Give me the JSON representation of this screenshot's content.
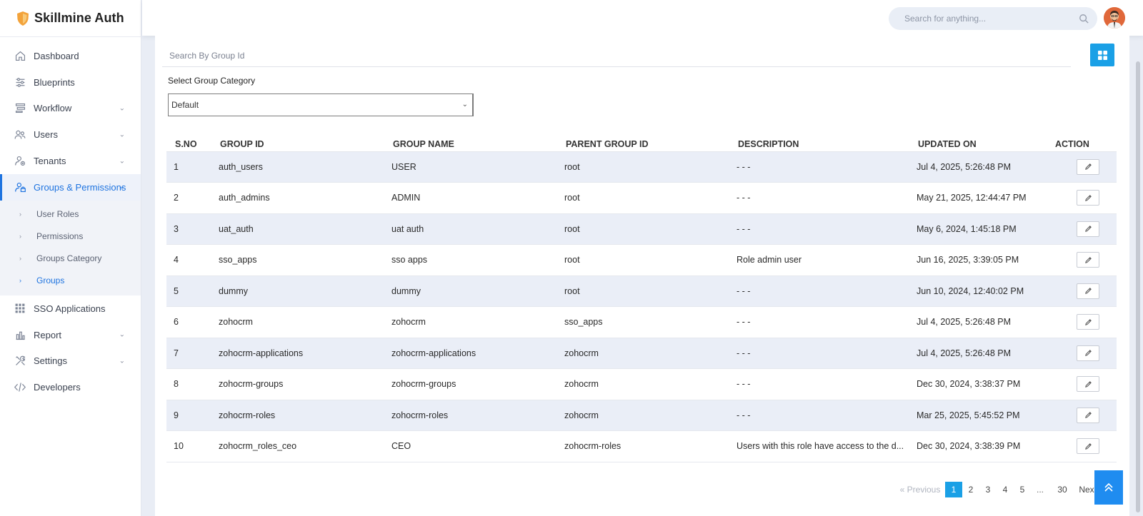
{
  "app": {
    "name": "Skillmine Auth"
  },
  "header": {
    "search_placeholder": "Search for anything..."
  },
  "sidebar": {
    "items": [
      {
        "label": "Dashboard",
        "icon": "home-icon",
        "has_chevron": false
      },
      {
        "label": "Blueprints",
        "icon": "sliders-icon",
        "has_chevron": false
      },
      {
        "label": "Workflow",
        "icon": "workflow-icon",
        "has_chevron": true
      },
      {
        "label": "Users",
        "icon": "users-icon",
        "has_chevron": true
      },
      {
        "label": "Tenants",
        "icon": "tenant-icon",
        "has_chevron": true
      },
      {
        "label": "Groups & Permissions",
        "icon": "user-lock-icon",
        "has_chevron": true,
        "active": true
      },
      {
        "label": "SSO Applications",
        "icon": "grid-icon",
        "has_chevron": false
      },
      {
        "label": "Report",
        "icon": "bar-chart-icon",
        "has_chevron": true
      },
      {
        "label": "Settings",
        "icon": "tools-icon",
        "has_chevron": true
      },
      {
        "label": "Developers",
        "icon": "code-icon",
        "has_chevron": false
      }
    ],
    "submenu": [
      {
        "label": "User Roles"
      },
      {
        "label": "Permissions"
      },
      {
        "label": "Groups Category"
      },
      {
        "label": "Groups",
        "active": true
      }
    ]
  },
  "main": {
    "group_search_placeholder": "Search By Group Id",
    "category_label": "Select Group Category",
    "category_value": "Default",
    "columns": [
      "S.NO",
      "GROUP ID",
      "GROUP NAME",
      "PARENT GROUP ID",
      "DESCRIPTION",
      "UPDATED ON",
      "ACTION"
    ],
    "rows": [
      {
        "sno": "1",
        "group_id": "auth_users",
        "group_name": "USER",
        "parent": "root",
        "description": "- - -",
        "updated": "Jul 4, 2025, 5:26:48 PM"
      },
      {
        "sno": "2",
        "group_id": "auth_admins",
        "group_name": "ADMIN",
        "parent": "root",
        "description": "- - -",
        "updated": "May 21, 2025, 12:44:47 PM"
      },
      {
        "sno": "3",
        "group_id": "uat_auth",
        "group_name": "uat auth",
        "parent": "root",
        "description": "- - -",
        "updated": "May 6, 2024, 1:45:18 PM"
      },
      {
        "sno": "4",
        "group_id": "sso_apps",
        "group_name": "sso apps",
        "parent": "root",
        "description": "Role admin user",
        "updated": "Jun 16, 2025, 3:39:05 PM"
      },
      {
        "sno": "5",
        "group_id": "dummy",
        "group_name": "dummy",
        "parent": "root",
        "description": "- - -",
        "updated": "Jun 10, 2024, 12:40:02 PM"
      },
      {
        "sno": "6",
        "group_id": "zohocrm",
        "group_name": "zohocrm",
        "parent": "sso_apps",
        "description": "- - -",
        "updated": "Jul 4, 2025, 5:26:48 PM"
      },
      {
        "sno": "7",
        "group_id": "zohocrm-applications",
        "group_name": "zohocrm-applications",
        "parent": "zohocrm",
        "description": "- - -",
        "updated": "Jul 4, 2025, 5:26:48 PM"
      },
      {
        "sno": "8",
        "group_id": "zohocrm-groups",
        "group_name": "zohocrm-groups",
        "parent": "zohocrm",
        "description": "- - -",
        "updated": "Dec 30, 2024, 3:38:37 PM"
      },
      {
        "sno": "9",
        "group_id": "zohocrm-roles",
        "group_name": "zohocrm-roles",
        "parent": "zohocrm",
        "description": "- - -",
        "updated": "Mar 25, 2025, 5:45:52 PM"
      },
      {
        "sno": "10",
        "group_id": "zohocrm_roles_ceo",
        "group_name": "CEO",
        "parent": "zohocrm-roles",
        "description": "Users with this role have access to the d...",
        "updated": "Dec 30, 2024, 3:38:39 PM"
      }
    ]
  },
  "pagination": {
    "previous": "« Previous",
    "pages": [
      "1",
      "2",
      "3",
      "4",
      "5"
    ],
    "ellipsis": "...",
    "last": "30",
    "next": "Nex",
    "current": "1"
  },
  "colors": {
    "accent": "#1f74e0",
    "button": "#1aa0e6",
    "stripe": "#eaeef7"
  }
}
